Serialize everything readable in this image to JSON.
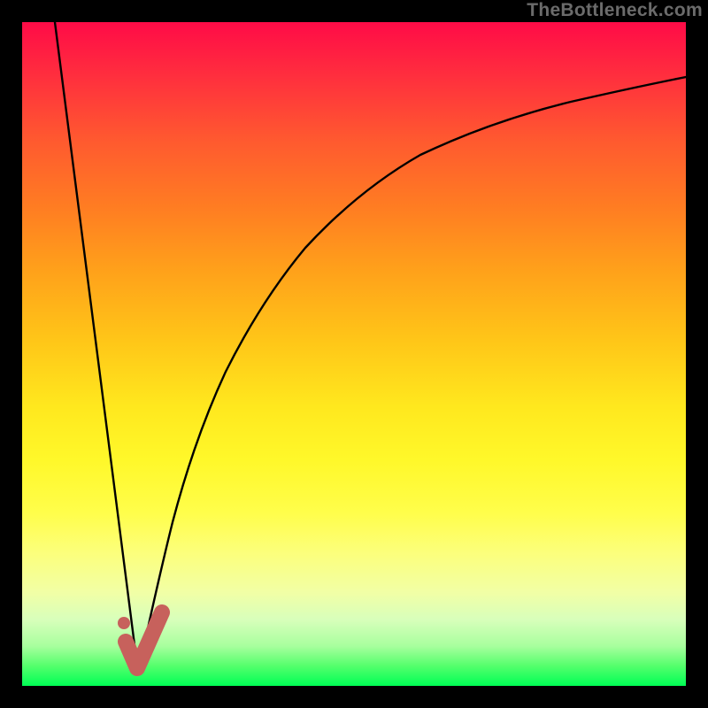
{
  "watermark": "TheBottleneck.com",
  "colors": {
    "frame": "#000000",
    "curve": "#000000",
    "marker": "#c7615c",
    "gradient_top": "#ff0b47",
    "gradient_bottom": "#00ff55"
  },
  "chart_data": {
    "type": "line",
    "title": "",
    "xlabel": "",
    "ylabel": "",
    "xlim": [
      0,
      100
    ],
    "ylim": [
      0,
      100
    ],
    "annotations": [],
    "series": [
      {
        "name": "descending-branch",
        "x": [
          5,
          17.5
        ],
        "values": [
          100,
          2
        ]
      },
      {
        "name": "ascending-curve",
        "x": [
          17.5,
          22,
          27,
          33,
          40,
          48,
          57,
          67,
          80,
          100
        ],
        "values": [
          2,
          24,
          42,
          56,
          67,
          75,
          81,
          85.5,
          89,
          92
        ]
      }
    ],
    "marker": {
      "name": "check-marker",
      "points_x": [
        15.5,
        17.3,
        21
      ],
      "points_y": [
        6.5,
        2.5,
        11
      ],
      "dot": {
        "x": 15.3,
        "y": 9.5
      }
    }
  }
}
